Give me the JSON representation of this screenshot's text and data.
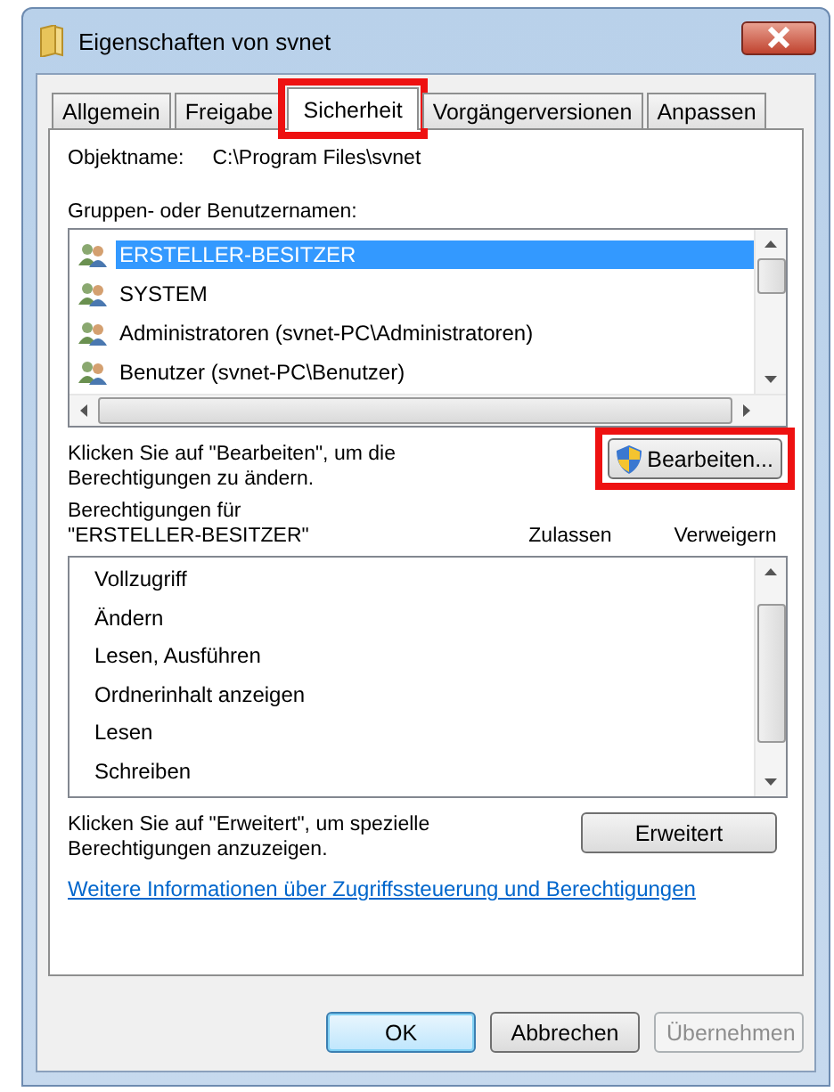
{
  "window": {
    "title": "Eigenschaften von svnet"
  },
  "tabs": [
    {
      "label": "Allgemein",
      "selected": false,
      "highlighted": false
    },
    {
      "label": "Freigabe",
      "selected": false,
      "highlighted": false
    },
    {
      "label": "Sicherheit",
      "selected": true,
      "highlighted": true
    },
    {
      "label": "Vorgängerversionen",
      "selected": false,
      "highlighted": false
    },
    {
      "label": "Anpassen",
      "selected": false,
      "highlighted": false
    }
  ],
  "object_name": {
    "label": "Objektname:",
    "value": "C:\\Program Files\\svnet"
  },
  "groups": {
    "label": "Gruppen- oder Benutzernamen:",
    "items": [
      {
        "name": "ERSTELLER-BESITZER",
        "selected": true
      },
      {
        "name": "SYSTEM",
        "selected": false
      },
      {
        "name": "Administratoren (svnet-PC\\Administratoren)",
        "selected": false
      },
      {
        "name": "Benutzer (svnet-PC\\Benutzer)",
        "selected": false
      }
    ]
  },
  "edit_hint": "Klicken Sie auf \"Bearbeiten\", um die Berechtigungen zu ändern.",
  "edit_button": {
    "label": "Bearbeiten...",
    "highlighted": true
  },
  "permissions": {
    "label": "Berechtigungen für \"ERSTELLER-BESITZER\"",
    "column_allow": "Zulassen",
    "column_deny": "Verweigern",
    "rows": [
      "Vollzugriff",
      "Ändern",
      "Lesen, Ausführen",
      "Ordnerinhalt anzeigen",
      "Lesen",
      "Schreiben"
    ]
  },
  "advanced_hint": "Klicken Sie auf \"Erweitert\", um spezielle Berechtigungen anzuzeigen.",
  "advanced_button": "Erweitert",
  "info_link": "Weitere Informationen über Zugriffssteuerung und Berechtigungen",
  "buttons": [
    {
      "label": "OK",
      "kind": "default",
      "disabled": false
    },
    {
      "label": "Abbrechen",
      "kind": "normal",
      "disabled": false
    },
    {
      "label": "Übernehmen",
      "kind": "normal",
      "disabled": true
    }
  ]
}
